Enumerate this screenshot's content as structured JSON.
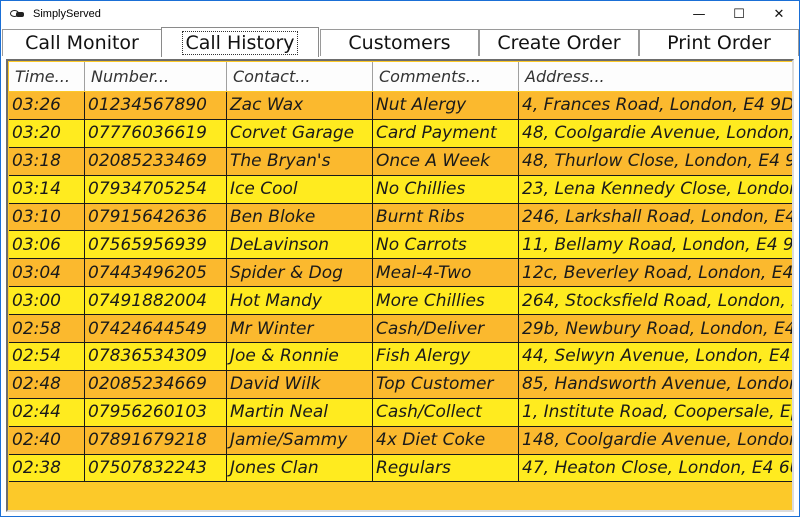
{
  "window": {
    "title": "SimplyServed"
  },
  "window_controls": {
    "minimize": "—",
    "maximize": "☐",
    "close": "✕"
  },
  "tabs": [
    {
      "label": "Call Monitor",
      "active": false
    },
    {
      "label": "Call History",
      "active": true
    },
    {
      "label": "Customers",
      "active": false
    },
    {
      "label": "Create Order",
      "active": false
    },
    {
      "label": "Print Order",
      "active": false
    }
  ],
  "grid": {
    "columns": [
      "Time...",
      "Number...",
      "Contact...",
      "Comments...",
      "Address..."
    ],
    "row_colors": {
      "odd": "#fbb92e",
      "even": "#ffeb1f",
      "background": "#fcc929"
    },
    "rows": [
      [
        "03:26",
        "01234567890",
        "Zac Wax",
        "Nut Alergy",
        "4, Frances Road, London, E4 9DH"
      ],
      [
        "03:20",
        "07776036619",
        "Corvet Garage",
        "Card Payment",
        "48, Coolgardie Avenue, London, E4"
      ],
      [
        "03:18",
        "02085233469",
        "The Bryan's",
        "Once A Week",
        "48, Thurlow Close, London, E4 9X"
      ],
      [
        "03:14",
        "07934705254",
        "Ice Cool",
        "No Chillies",
        "23, Lena Kennedy Close, London, E"
      ],
      [
        "03:10",
        "07915642636",
        "Ben Bloke",
        "Burnt Ribs",
        "246, Larkshall Road, London, E4 6"
      ],
      [
        "03:06",
        "07565956939",
        "DeLavinson",
        "No Carrots",
        "11, Bellamy Road, London, E4 9N"
      ],
      [
        "03:04",
        "07443496205",
        "Spider & Dog",
        "Meal-4-Two",
        "12c, Beverley Road, London, E4 9"
      ],
      [
        "03:00",
        "07491882004",
        "Hot Mandy",
        "More Chillies",
        "264, Stocksfield Road, London, E."
      ],
      [
        "02:58",
        "07424644549",
        "Mr Winter",
        "Cash/Deliver",
        "29b, Newbury Road, London, E4 9"
      ],
      [
        "02:54",
        "07836534309",
        "Joe & Ronnie",
        "Fish Alergy",
        "44, Selwyn Avenue, London, E4 9"
      ],
      [
        "02:48",
        "02085234669",
        "David Wilk",
        "Top Customer",
        "85, Handsworth Avenue, London, E"
      ],
      [
        "02:44",
        "07956260103",
        "Martin Neal",
        "Cash/Collect",
        "1, Institute Road, Coopersale, Epp"
      ],
      [
        "02:40",
        "07891679218",
        "Jamie/Sammy",
        "4x Diet Coke",
        "148, Coolgardie Avenue, London, E"
      ],
      [
        "02:38",
        "07507832243",
        "Jones Clan",
        "Regulars",
        "47, Heaton Close, London, E4 6U"
      ]
    ]
  }
}
